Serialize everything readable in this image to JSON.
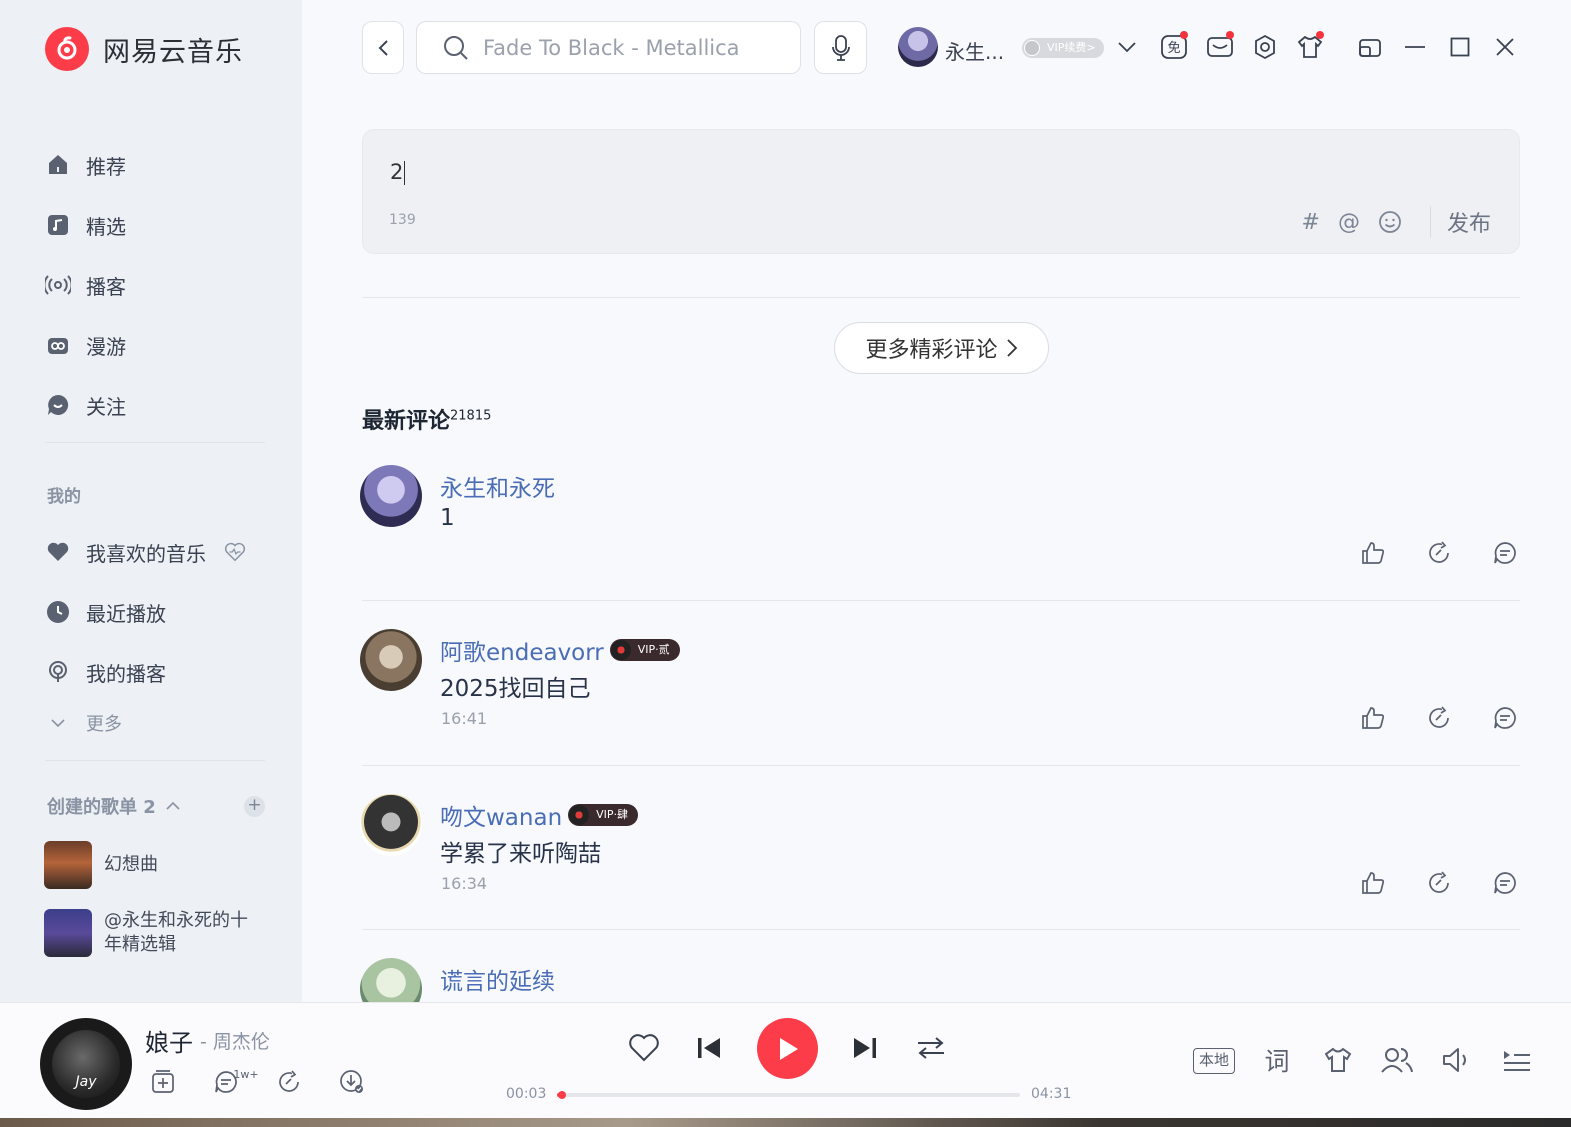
{
  "app": {
    "name": "网易云音乐",
    "brand_color": "#fc3d49"
  },
  "sidebar": {
    "nav": [
      {
        "label": "推荐",
        "icon": "home-icon"
      },
      {
        "label": "精选",
        "icon": "music-note-icon"
      },
      {
        "label": "播客",
        "icon": "broadcast-icon"
      },
      {
        "label": "漫游",
        "icon": "radio-icon"
      },
      {
        "label": "关注",
        "icon": "chat-bubble-icon"
      }
    ],
    "mine_label": "我的",
    "mine": [
      {
        "label": "我喜欢的音乐",
        "icon": "heart-icon"
      },
      {
        "label": "最近播放",
        "icon": "clock-icon"
      },
      {
        "label": "我的播客",
        "icon": "podcast-icon"
      }
    ],
    "more_label": "更多",
    "created_label": "创建的歌单 2",
    "add_symbol": "+",
    "playlists": [
      {
        "name": "幻想曲"
      },
      {
        "name": "@永生和永死的十年精选辑"
      }
    ]
  },
  "topbar": {
    "search_placeholder": "Fade To Black - Metallica",
    "username": "永生...",
    "vip_badge": "VIP续费>"
  },
  "composer": {
    "text": "2",
    "remaining": "139",
    "tools": {
      "hashtag": "#",
      "mention": "@"
    },
    "publish_label": "发布"
  },
  "more_comments_label": "更多精彩评论",
  "latest": {
    "title": "最新评论",
    "count": "21815"
  },
  "comments": [
    {
      "user": "永生和永死",
      "text": "1",
      "time": "",
      "vip": ""
    },
    {
      "user": "阿歌endeavorr",
      "text": "2025找回自己",
      "time": "16:41",
      "vip": "VIP·贰"
    },
    {
      "user": "吻文wanan",
      "text": "学累了来听陶喆",
      "time": "16:34",
      "vip": "VIP·肆"
    },
    {
      "user": "谎言的延续",
      "text": "",
      "time": "",
      "vip": ""
    }
  ],
  "player": {
    "title": "娘子",
    "artist": "- 周杰伦",
    "album_text": "Jay",
    "comment_count": "1w+",
    "elapsed": "00:03",
    "duration": "04:31",
    "progress": 0.011,
    "local_label": "本地",
    "lyric_label": "词"
  }
}
